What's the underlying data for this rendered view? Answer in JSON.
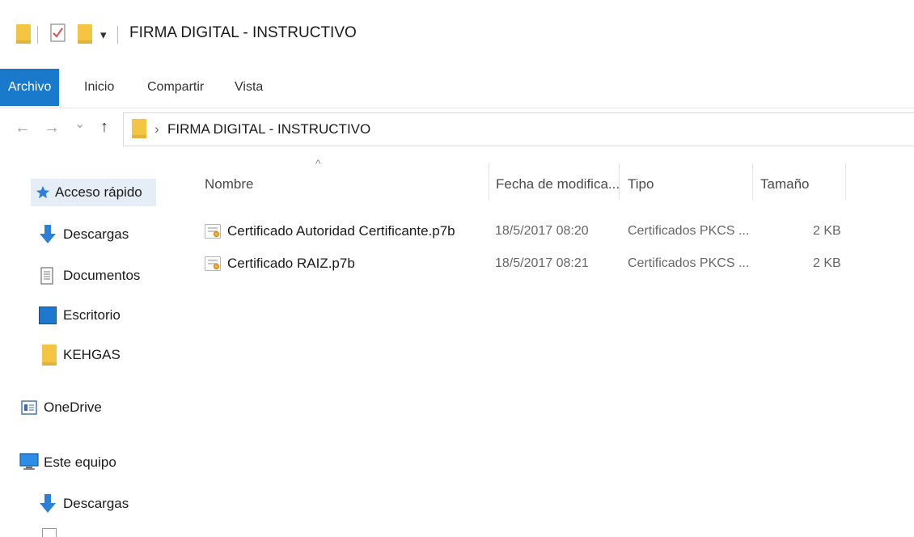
{
  "window": {
    "title": "FIRMA DIGITAL - INSTRUCTIVO",
    "qat_dropdown": "▾"
  },
  "ribbon": {
    "tabs": [
      {
        "label": "Archivo",
        "active": true
      },
      {
        "label": "Inicio",
        "active": false
      },
      {
        "label": "Compartir",
        "active": false
      },
      {
        "label": "Vista",
        "active": false
      }
    ]
  },
  "address": {
    "back": "←",
    "forward": "→",
    "recent": "⌄",
    "up": "↑",
    "separator": "›",
    "path": "FIRMA DIGITAL - INSTRUCTIVO"
  },
  "sidebar": {
    "items": [
      {
        "label": "Acceso rápido",
        "icon": "star-icon",
        "selected": true
      },
      {
        "label": "Descargas",
        "icon": "download-icon"
      },
      {
        "label": "Documentos",
        "icon": "document-icon"
      },
      {
        "label": "Escritorio",
        "icon": "desktop-icon"
      },
      {
        "label": "KEHGAS",
        "icon": "folder-icon"
      },
      {
        "label": "OneDrive",
        "icon": "onedrive-icon"
      },
      {
        "label": "Este equipo",
        "icon": "computer-icon"
      },
      {
        "label": "Descargas",
        "icon": "download-icon"
      }
    ]
  },
  "columns": {
    "sort_indicator": "^",
    "name": "Nombre",
    "date": "Fecha de modifica...",
    "type": "Tipo",
    "size": "Tamaño"
  },
  "files": [
    {
      "name": "Certificado Autoridad Certificante.p7b",
      "date": "18/5/2017 08:20",
      "type": "Certificados PKCS ...",
      "size": "2 KB",
      "icon": "certificate-icon"
    },
    {
      "name": "Certificado RAIZ.p7b",
      "date": "18/5/2017 08:21",
      "type": "Certificados PKCS ...",
      "size": "2 KB",
      "icon": "certificate-icon"
    }
  ],
  "colors": {
    "accent": "#1979ca",
    "folder": "#f4c542",
    "selection": "#e5eef7"
  }
}
